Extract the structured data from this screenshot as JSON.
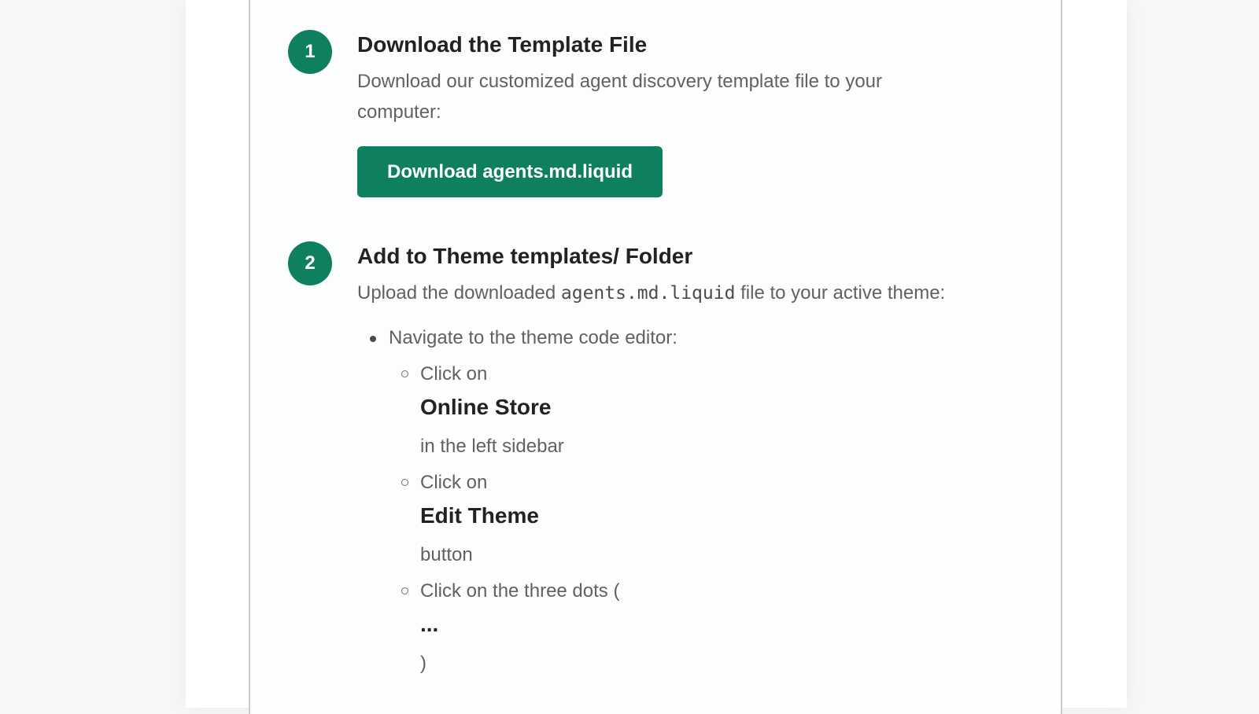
{
  "steps": [
    {
      "number": "1",
      "title": "Download the Template File",
      "description": "Download our customized agent discovery template file to your computer:",
      "button_label": "Download agents.md.liquid"
    },
    {
      "number": "2",
      "title": "Add to Theme templates/ Folder",
      "desc_before": "Upload the downloaded ",
      "desc_code": "agents.md.liquid",
      "desc_after": " file to your active theme:",
      "list": {
        "item": "Navigate to the theme code editor:",
        "subitems": [
          {
            "before": "Click on",
            "emphasis": "Online Store",
            "after": "in the left sidebar"
          },
          {
            "before": "Click on",
            "emphasis": "Edit Theme",
            "after": "button"
          },
          {
            "before": "Click on the three dots (",
            "emphasis": "...",
            "after": ")"
          }
        ]
      }
    }
  ],
  "colors": {
    "accent": "#0e8060",
    "heading": "#202223",
    "body_text": "#5f6163",
    "card_border": "#c9cbcd"
  }
}
